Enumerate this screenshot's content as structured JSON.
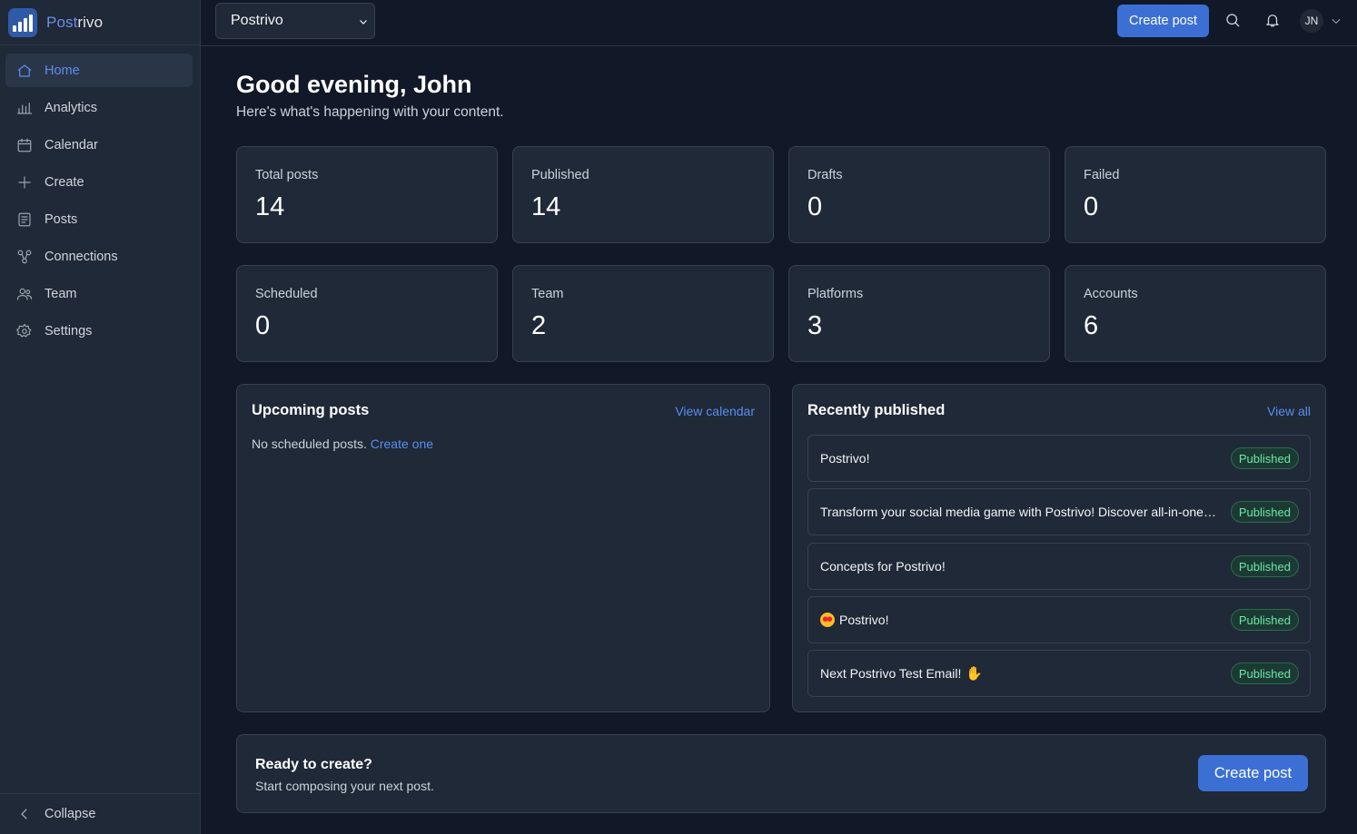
{
  "brand": {
    "name_part1": "Post",
    "name_part2": "rivo"
  },
  "sidebar": {
    "items": [
      {
        "label": "Home",
        "icon": "home-icon",
        "active": true
      },
      {
        "label": "Analytics",
        "icon": "analytics-icon"
      },
      {
        "label": "Calendar",
        "icon": "calendar-icon"
      },
      {
        "label": "Create",
        "icon": "plus-icon"
      },
      {
        "label": "Posts",
        "icon": "document-icon"
      },
      {
        "label": "Connections",
        "icon": "connections-icon"
      },
      {
        "label": "Team",
        "icon": "team-icon"
      },
      {
        "label": "Settings",
        "icon": "gear-icon"
      }
    ],
    "collapse_label": "Collapse"
  },
  "topbar": {
    "workspace": "Postrivo",
    "create_label": "Create post",
    "avatar_initials": "JN"
  },
  "main": {
    "greeting": "Good evening, John",
    "subtitle": "Here's what's happening with your content.",
    "stats": [
      {
        "label": "Total posts",
        "value": "14"
      },
      {
        "label": "Published",
        "value": "14"
      },
      {
        "label": "Drafts",
        "value": "0"
      },
      {
        "label": "Failed",
        "value": "0"
      },
      {
        "label": "Scheduled",
        "value": "0"
      },
      {
        "label": "Team",
        "value": "2"
      },
      {
        "label": "Platforms",
        "value": "3"
      },
      {
        "label": "Accounts",
        "value": "6"
      }
    ],
    "upcoming": {
      "title": "Upcoming posts",
      "link": "View calendar",
      "empty_text": "No scheduled posts.",
      "empty_link": "Create one"
    },
    "recent": {
      "title": "Recently published",
      "link": "View all",
      "items": [
        {
          "text": "Postrivo!",
          "status": "Published"
        },
        {
          "text": "Transform your social media game with Postrivo! Discover all-in-one scheduling, analytics and team collaboration",
          "status": "Published"
        },
        {
          "text": "Concepts for Postrivo!",
          "status": "Published"
        },
        {
          "text": "Postrivo!",
          "status": "Published",
          "emoji": "heart-eyes-emoji"
        },
        {
          "text": "Next Postrivo Test Email!",
          "status": "Published",
          "emoji_after": "thumbs-up-emoji"
        }
      ]
    },
    "cta": {
      "title": "Ready to create?",
      "subtitle": "Start composing your next post.",
      "button": "Create post"
    }
  },
  "colors": {
    "accent": "#3b6fd4",
    "link": "#5b8def",
    "success": "#6ee7a8",
    "bg": "#111827",
    "card": "#1f2937"
  }
}
